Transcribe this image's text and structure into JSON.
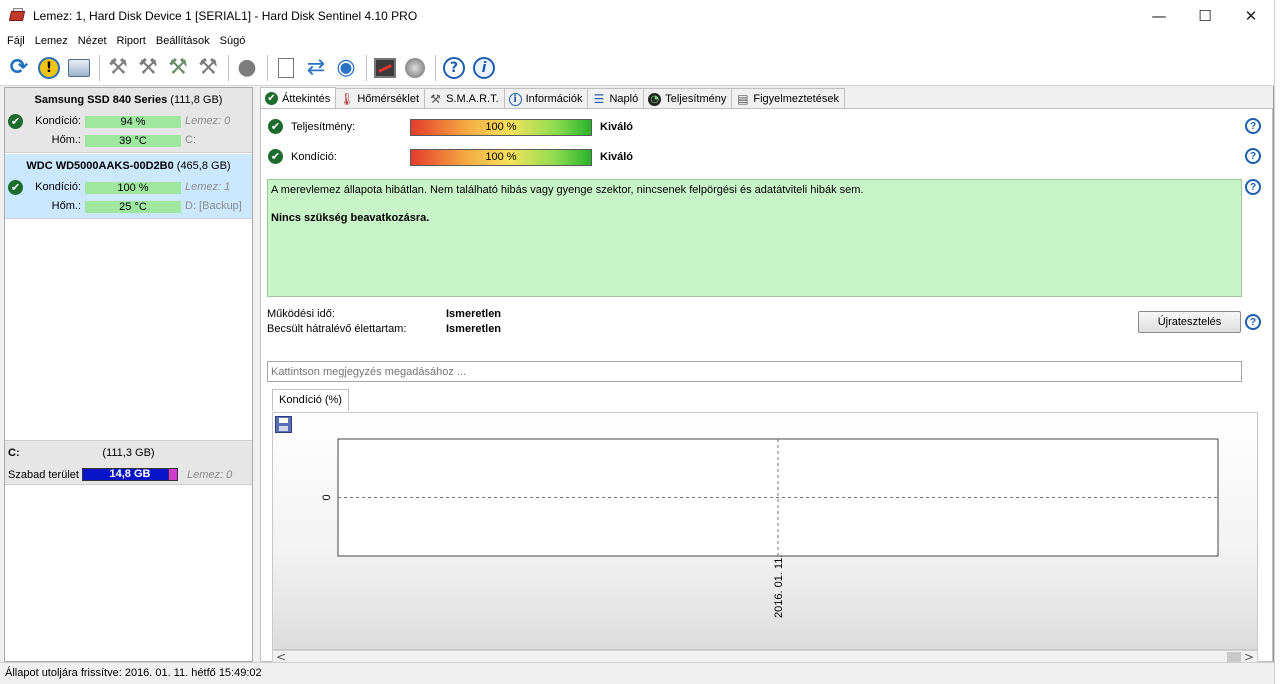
{
  "window": {
    "title": "Lemez: 1, Hard Disk Device 1 [SERIAL1]  -  Hard Disk Sentinel 4.10 PRO",
    "minimize": "—",
    "maximize": "☐",
    "close": "✕"
  },
  "menu": [
    {
      "label": "Fájl"
    },
    {
      "label": "Lemez"
    },
    {
      "label": "Nézet"
    },
    {
      "label": "Riport"
    },
    {
      "label": "Beállítások"
    },
    {
      "label": "Súgó"
    }
  ],
  "toolbar": {
    "warning_glyph": "!",
    "help_glyph": "?",
    "info_glyph": "i"
  },
  "disks": [
    {
      "name": "Samsung SSD 840 Series",
      "size": "(111,8 GB)",
      "health_label": "Kondíció:",
      "health_value": "94 %",
      "health_percent": 94,
      "health_right": "Lemez: 0",
      "temp_label": "Hőm.:",
      "temp_value": "39 °C",
      "temp_right": "C:"
    },
    {
      "name": "WDC WD5000AAKS-00D2B0",
      "size": "(465,8 GB)",
      "health_label": "Kondíció:",
      "health_value": "100 %",
      "health_percent": 100,
      "health_right": "Lemez: 1",
      "temp_label": "Hőm.:",
      "temp_value": "25 °C",
      "temp_right": "D: [Backup]"
    }
  ],
  "volume": {
    "name": "C:",
    "size": "(111,3 GB)",
    "free_label": "Szabad terület",
    "free_value": "14,8 GB",
    "disk_ref": "Lemez: 0"
  },
  "tabs": [
    {
      "label": "Áttekintés",
      "active": true
    },
    {
      "label": "Hőmérséklet"
    },
    {
      "label": "S.M.A.R.T."
    },
    {
      "label": "Információk"
    },
    {
      "label": "Napló"
    },
    {
      "label": "Teljesítmény"
    },
    {
      "label": "Figyelmeztetések"
    }
  ],
  "overview": {
    "performance": {
      "label": "Teljesítmény:",
      "value": "100 %",
      "percent": 100,
      "rating": "Kiváló"
    },
    "health": {
      "label": "Kondíció:",
      "value": "100 %",
      "percent": 100,
      "rating": "Kiváló"
    },
    "status_text": "A merevlemez állapota hibátlan. Nem található hibás vagy gyenge szektor, nincsenek felpörgési és adatátviteli hibák sem.",
    "status_action": "Nincs szükség beavatkozásra.",
    "power_on_label": "Működési idő:",
    "power_on_value": "Ismeretlen",
    "lifetime_label": "Becsült hátralévő élettartam:",
    "lifetime_value": "Ismeretlen",
    "retest_button": "Újratesztelés",
    "note_placeholder": "Kattintson megjegyzés megadásához ...",
    "help_glyph": "?"
  },
  "chart_tab_label": "Kondíció  (%)",
  "chart_data": {
    "type": "line",
    "x": [
      "2016. 01. 11."
    ],
    "y_ticks": [
      "0"
    ],
    "series": [
      {
        "values": []
      }
    ],
    "gridlines": "dashed"
  },
  "statusbar": {
    "text": "Állapot utoljára frissítve: 2016. 01. 11. hétfő 15:49:02"
  },
  "scroll_left": "<",
  "scroll_right": ">"
}
